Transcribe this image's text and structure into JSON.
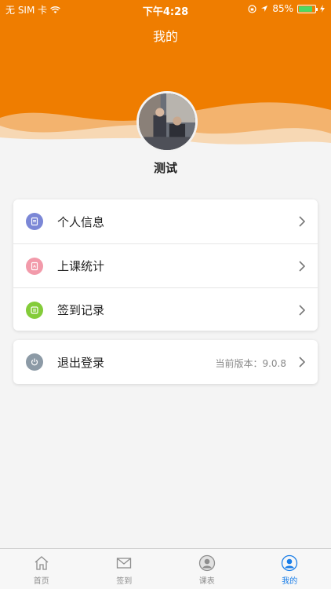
{
  "status_bar": {
    "carrier": "无 SIM 卡",
    "time": "下午4:28",
    "battery_percent": "85%",
    "battery_level": 0.85
  },
  "header": {
    "title": "我的",
    "bg_color": "#ef7d00"
  },
  "profile": {
    "username": "测试"
  },
  "menu": {
    "items": [
      {
        "label": "个人信息",
        "icon": "document-icon",
        "color": "#7b87d6"
      },
      {
        "label": "上课统计",
        "icon": "stats-icon",
        "color": "#f29aaa"
      },
      {
        "label": "签到记录",
        "icon": "checkin-icon",
        "color": "#84cc3a"
      }
    ],
    "logout": {
      "label": "退出登录",
      "icon": "power-icon",
      "color": "#8c9aa6",
      "version": "当前版本：9.0.8"
    }
  },
  "tabbar": {
    "items": [
      {
        "label": "首页",
        "icon": "home-icon"
      },
      {
        "label": "签到",
        "icon": "mail-icon"
      },
      {
        "label": "课表",
        "icon": "user-circle-icon"
      },
      {
        "label": "我的",
        "icon": "user-circle-active-icon"
      }
    ],
    "active_color": "#1a7ee8"
  }
}
